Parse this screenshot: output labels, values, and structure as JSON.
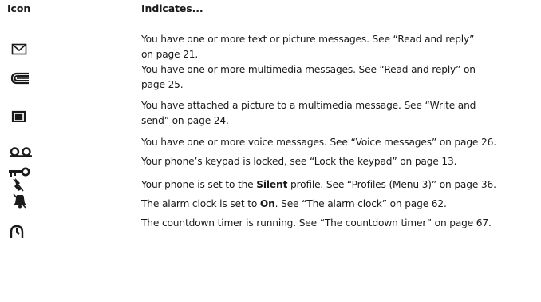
{
  "header": {
    "icon_col": "Icon",
    "indicates_col": "Indicates..."
  },
  "rows": [
    {
      "icon": "envelope-icon",
      "lines": [
        "You have one or more text or picture messages. See “Read and reply”",
        "on page 21."
      ]
    },
    {
      "icon": "multimedia-message-icon",
      "lines": [
        "You have one or more multimedia messages. See “Read and reply” on",
        "page 25."
      ]
    },
    {
      "icon": "picture-attachment-icon",
      "lines": [
        "You have attached a picture to a multimedia message. See “Write and",
        "send” on page 24."
      ]
    },
    {
      "icon": "voicemail-icon",
      "lines": [
        "You have one or more voice messages. See “Voice messages” on page 26."
      ]
    },
    {
      "icon": "key-lock-icon",
      "lines": [
        "Your phone’s keypad is locked, see “Lock the keypad” on page 13."
      ]
    },
    {
      "icon": "silent-bell-icon",
      "pre": "Your phone is set to the ",
      "bold": "Silent",
      "post": " profile. See “Profiles (Menu 3)” on page 36."
    },
    {
      "icon": "alarm-clock-icon",
      "pre": "The alarm clock is set to ",
      "bold": "On",
      "post": ". See “The alarm clock” on page 62."
    },
    {
      "icon": "countdown-timer-icon",
      "lines": [
        "The countdown timer is running. See “The countdown timer” on page 67."
      ]
    }
  ]
}
